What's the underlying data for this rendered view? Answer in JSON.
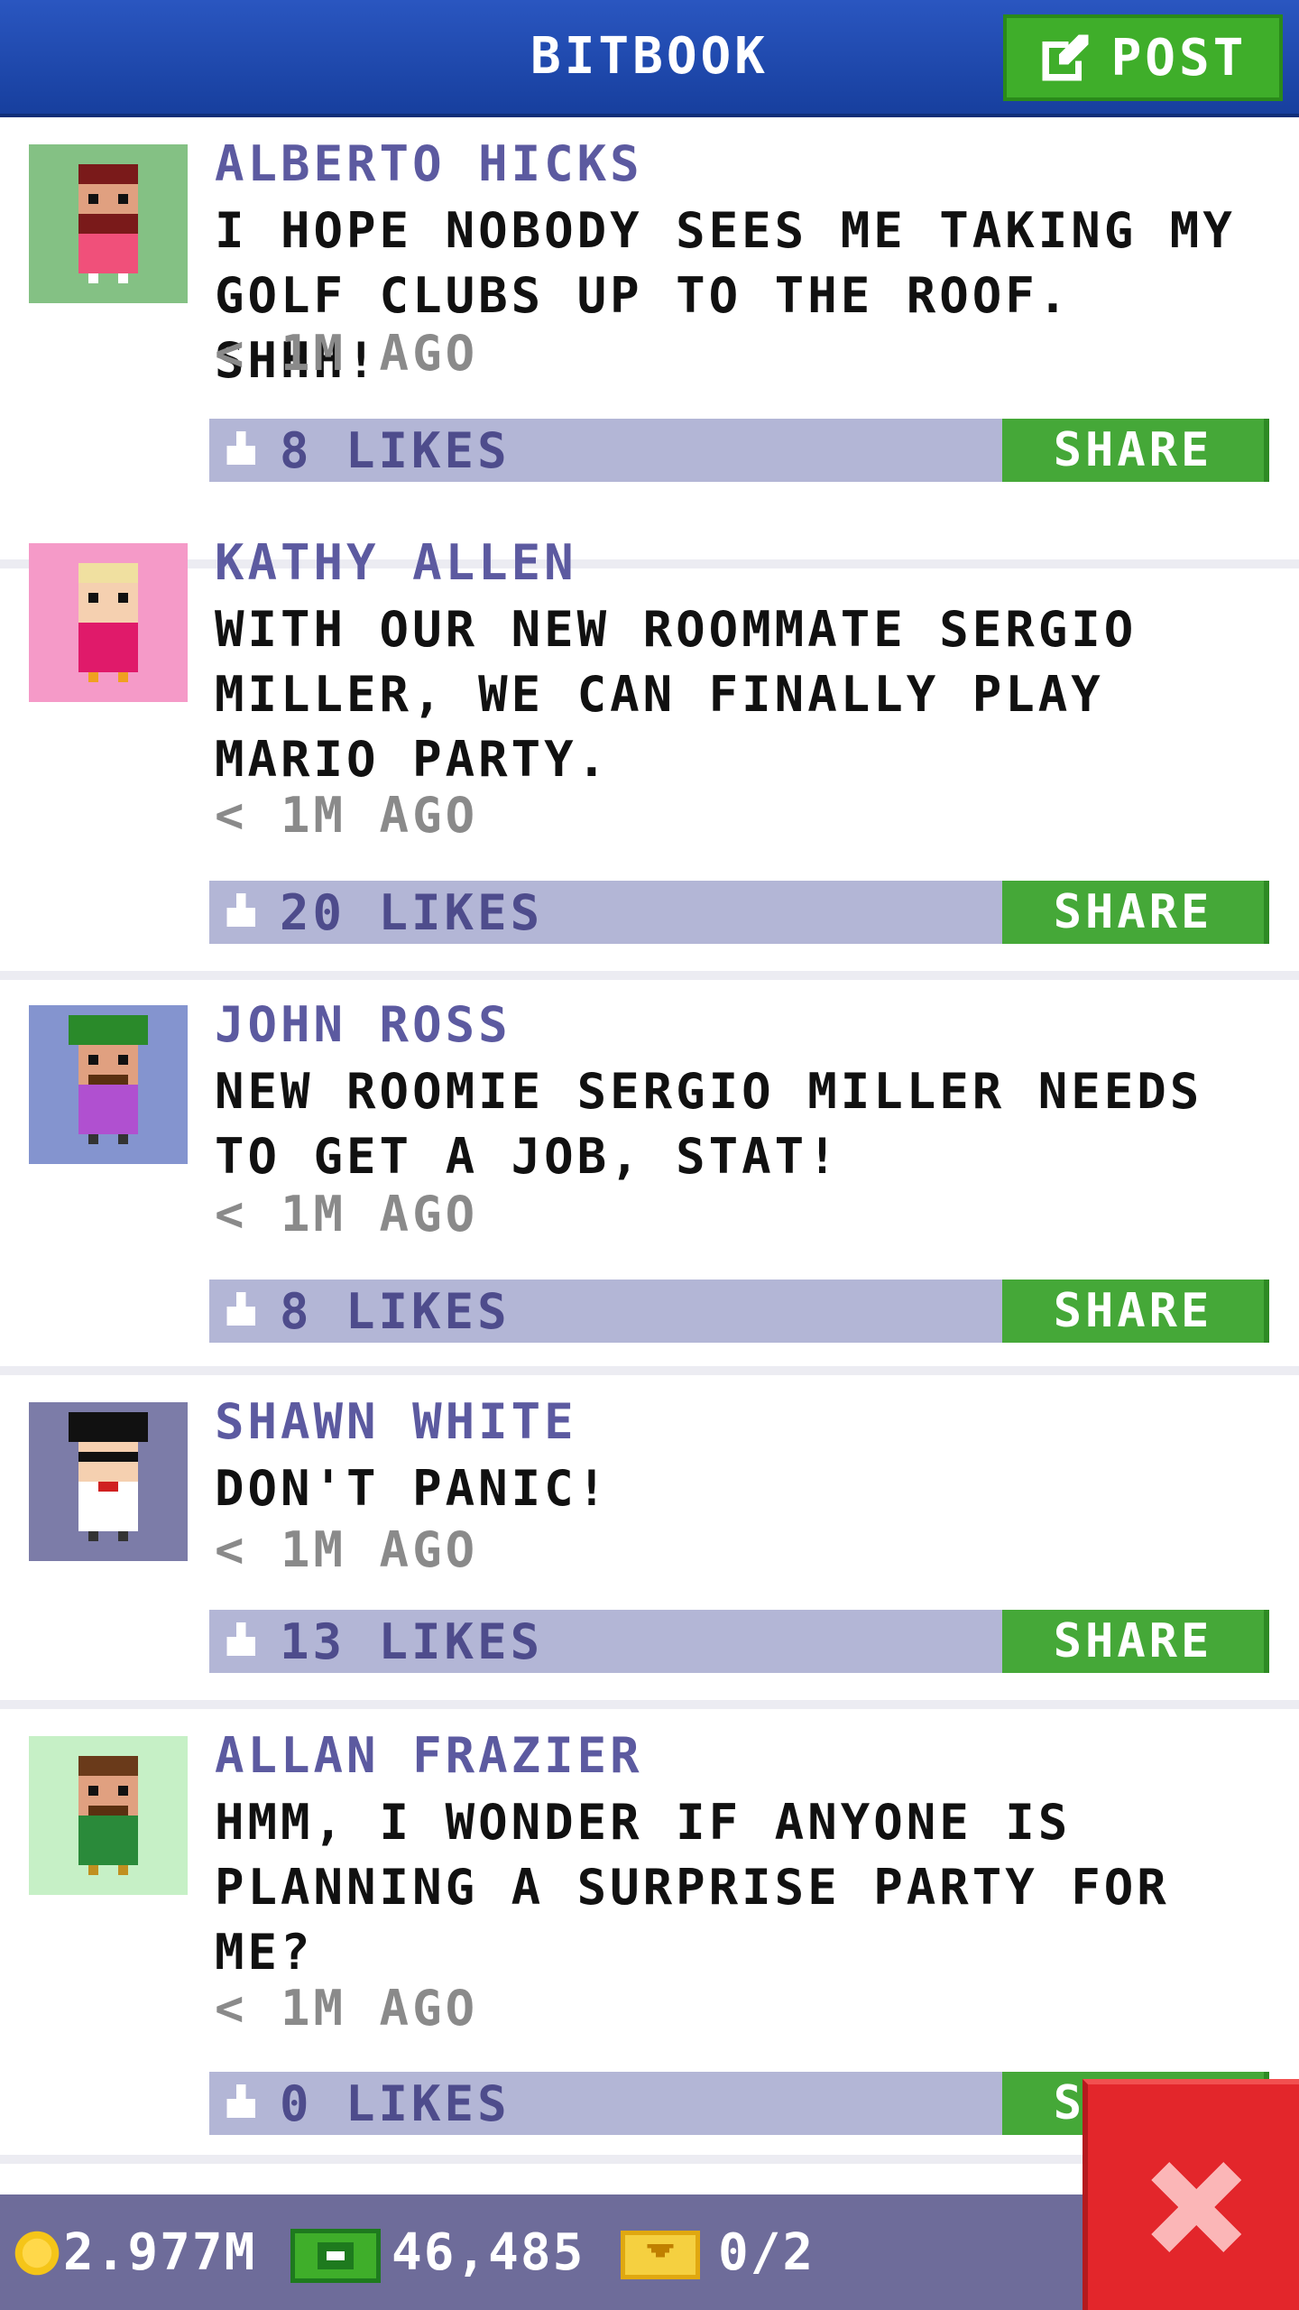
{
  "header": {
    "title": "BITBOOK",
    "post_label": "POST"
  },
  "posts": [
    {
      "author": "ALBERTO HICKS",
      "message": "I HOPE NOBODY SEES ME TAKING MY GOLF CLUBS UP TO THE ROOF. SHHH!",
      "time": "< 1M AGO",
      "likes": "8 LIKES",
      "share_label": "SHARE",
      "avatar_bg": "#84c184"
    },
    {
      "author": "KATHY ALLEN",
      "message": "WITH OUR NEW ROOMMATE SERGIO MILLER, WE CAN FINALLY PLAY MARIO PARTY.",
      "time": "< 1M AGO",
      "likes": "20 LIKES",
      "share_label": "SHARE",
      "avatar_bg": "#f59ac8"
    },
    {
      "author": "JOHN ROSS",
      "message": "NEW ROOMIE SERGIO MILLER NEEDS TO GET A JOB, STAT!",
      "time": "< 1M AGO",
      "likes": "8 LIKES",
      "share_label": "SHARE",
      "avatar_bg": "#8494cf"
    },
    {
      "author": "SHAWN WHITE",
      "message": "DON'T PANIC!",
      "time": "< 1M AGO",
      "likes": "13 LIKES",
      "share_label": "SHARE",
      "avatar_bg": "#7c7ca8"
    },
    {
      "author": "ALLAN FRAZIER",
      "message": "HMM, I WONDER IF ANYONE IS PLANNING A SURPRISE PARTY FOR ME?",
      "time": "< 1M AGO",
      "likes": "0 LIKES",
      "share_label": "SHARE",
      "avatar_bg": "#c6f0c6"
    }
  ],
  "status_bar": {
    "coins": "2.977M",
    "bux": "46,485",
    "tickets": "0/2"
  },
  "colors": {
    "header": "#1f4db4",
    "post_button": "#3fae2a",
    "likes_bar": "#b3b6d6",
    "share_button": "#45a838",
    "close_button": "#e3262b",
    "status_bar": "#6e6c9a"
  }
}
